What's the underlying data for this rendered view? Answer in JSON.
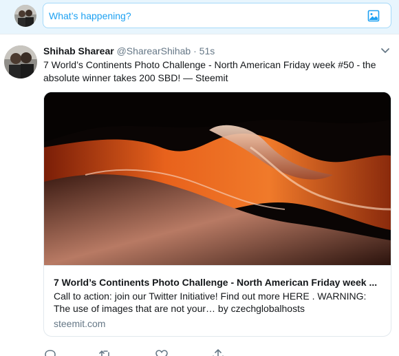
{
  "compose": {
    "placeholder": "What’s happening?",
    "avatar_icon": "profile-avatar",
    "media_icon": "image-icon"
  },
  "tweet": {
    "display_name": "Shihab Sharear",
    "handle": "@SharearShihab",
    "separator": "·",
    "timestamp": "51s",
    "text": "7 World’s Continents Photo Challenge - North American Friday week #50 - the absolute winner takes 200 SBD! — Steemit",
    "caret_icon": "chevron-down-icon",
    "card": {
      "title": "7 World’s Continents Photo Challenge - North American Friday week ...",
      "description": "Call to action: join our Twitter Initiative! Find out more HERE . WARNING: The use of images that are not your… by czechglobalhosts",
      "domain": "steemit.com",
      "image_description": "antelope-canyon-photo"
    },
    "actions": [
      "reply-icon",
      "retweet-icon",
      "like-icon",
      "share-icon"
    ]
  },
  "colors": {
    "accent": "#1da1f2",
    "compose_bg": "#e8f5fd",
    "muted_text": "#657786",
    "border": "#e1e8ed"
  }
}
